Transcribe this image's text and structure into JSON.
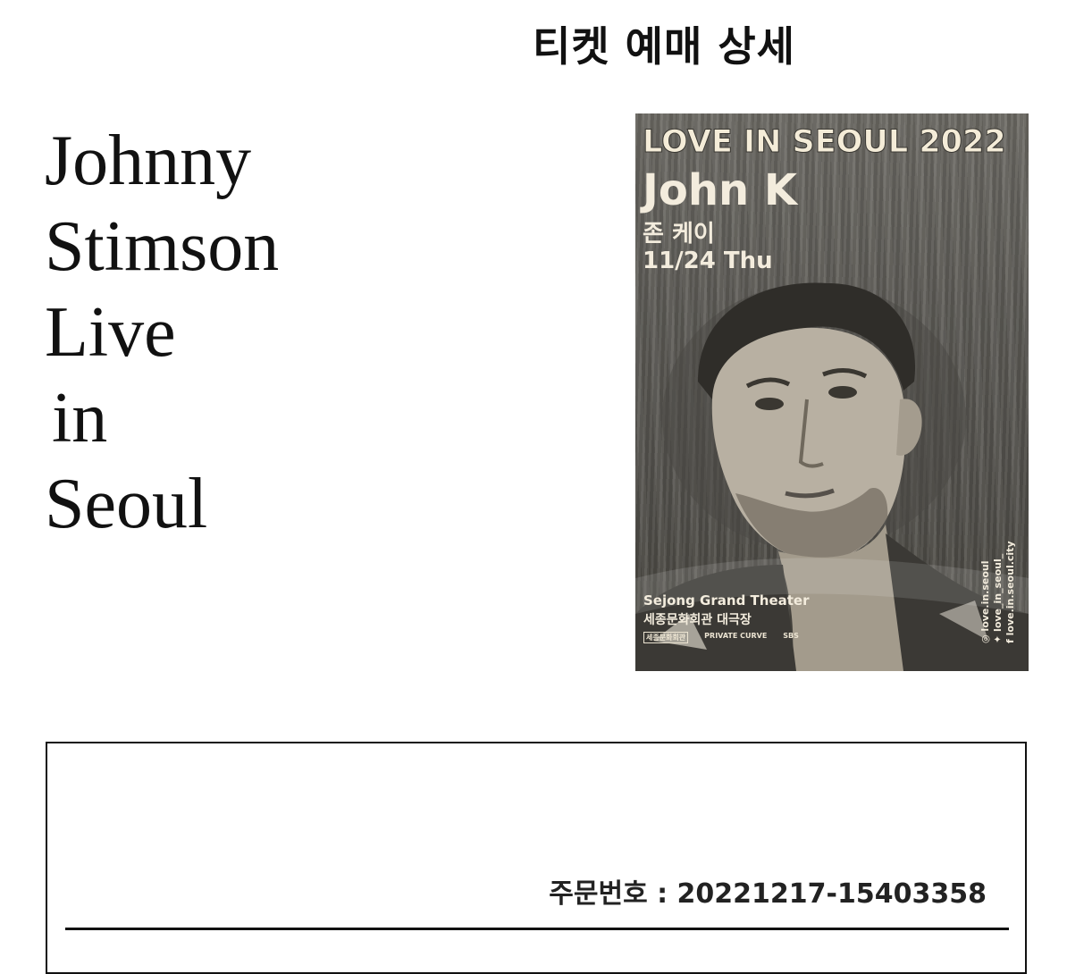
{
  "header": {
    "title": "티켓 예매 상세"
  },
  "event": {
    "title_lines": [
      "Johnny",
      "Stimson",
      "Live",
      "in",
      "Seoul"
    ]
  },
  "poster": {
    "headline": "LOVE IN SEOUL 2022",
    "artist": "John K",
    "artist_ko": "존 케이",
    "date": "11/24 Thu",
    "venue_en": "Sejong Grand Theater",
    "venue_ko": "세종문화회관 대극장",
    "sponsors": [
      "세종문화회관",
      "PRIVATE CURVE",
      "SBS"
    ],
    "social": [
      "love.in.seoul",
      "love_in_seoul_",
      "love.in.seoul.city"
    ]
  },
  "order": {
    "number_label": "주문번호 : 20221217-15403358"
  },
  "colors": {
    "text": "#111111",
    "border": "#111111",
    "poster_text": "#f3ecdd"
  }
}
